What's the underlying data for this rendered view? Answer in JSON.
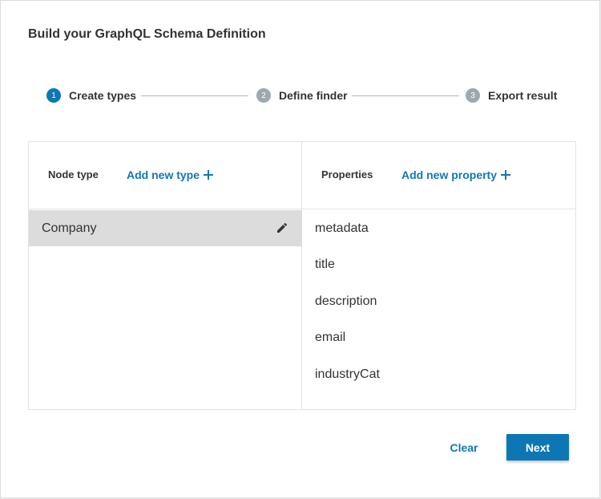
{
  "dialog": {
    "title": "Build your GraphQL Schema Definition"
  },
  "stepper": {
    "steps": [
      {
        "number": "1",
        "label": "Create types",
        "state": "active"
      },
      {
        "number": "2",
        "label": "Define finder",
        "state": "inactive"
      },
      {
        "number": "3",
        "label": "Export result",
        "state": "inactive"
      }
    ]
  },
  "node_panel": {
    "header_label": "Node type",
    "add_label": "Add new type",
    "add_icon": "plus-icon",
    "types": [
      {
        "name": "Company",
        "selected": true,
        "action_icon": "pencil-icon"
      }
    ]
  },
  "properties_panel": {
    "header_label": "Properties",
    "add_label": "Add new property",
    "add_icon": "plus-icon",
    "properties": [
      "metadata",
      "title",
      "description",
      "email",
      "industryCat"
    ]
  },
  "actions": {
    "clear_label": "Clear",
    "next_label": "Next"
  },
  "colors": {
    "accent": "#0d77b4",
    "link": "#1177b6",
    "inactive_step": "#9ea8b0",
    "selected_row": "#dcdcdc"
  }
}
